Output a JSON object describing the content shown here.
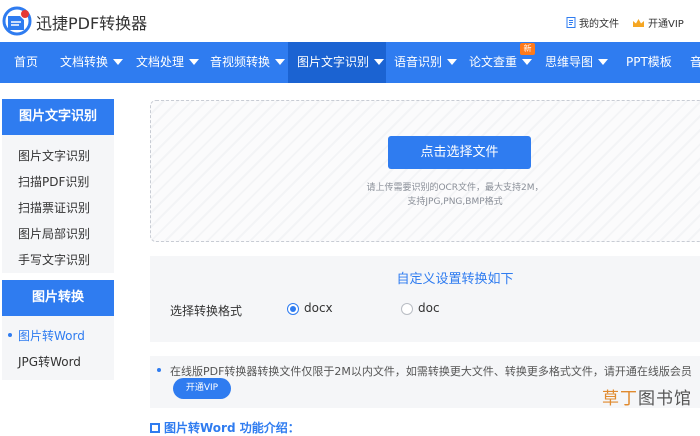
{
  "header": {
    "app_title": "迅捷PDF转换器",
    "my_files": "我的文件",
    "open_vip": "开通VIP"
  },
  "nav": {
    "items": [
      {
        "label": "首页"
      },
      {
        "label": "文档转换"
      },
      {
        "label": "文档处理"
      },
      {
        "label": "音视频转换"
      },
      {
        "label": "图片文字识别"
      },
      {
        "label": "语音识别"
      },
      {
        "label": "论文查重"
      },
      {
        "label": "思维导图"
      },
      {
        "label": "PPT模板"
      },
      {
        "label": "音"
      }
    ],
    "new_badge": "新"
  },
  "sidebar": {
    "group1_title": "图片文字识别",
    "group1_items": [
      {
        "label": "图片文字识别"
      },
      {
        "label": "扫描PDF识别"
      },
      {
        "label": "扫描票证识别"
      },
      {
        "label": "图片局部识别"
      },
      {
        "label": "手写文字识别"
      }
    ],
    "group2_title": "图片转换",
    "group2_items": [
      {
        "label": "图片转Word"
      },
      {
        "label": "JPG转Word"
      }
    ]
  },
  "upload": {
    "button_label": "点击选择文件",
    "hint_line1": "请上传需要识别的OCR文件，最大支持2M，",
    "hint_line2": "支持JPG,PNG,BMP格式"
  },
  "settings": {
    "title": "自定义设置转换如下",
    "format_label": "选择转换格式",
    "options": [
      {
        "label": "docx",
        "checked": true
      },
      {
        "label": "doc",
        "checked": false
      }
    ]
  },
  "notice": {
    "text": "在线版PDF转换器转换文件仅限于2M以内文件，如需转换更大文件、转换更多格式文件，请开通在线版会员",
    "vip_button": "开通VIP"
  },
  "section_heading": "图片转Word 功能介绍：",
  "watermark": {
    "part1": "草丁",
    "part2": "图书馆"
  },
  "colors": {
    "accent": "#2f7cf0",
    "nav_active": "#1b63d2",
    "badge": "#ff7a1a"
  }
}
